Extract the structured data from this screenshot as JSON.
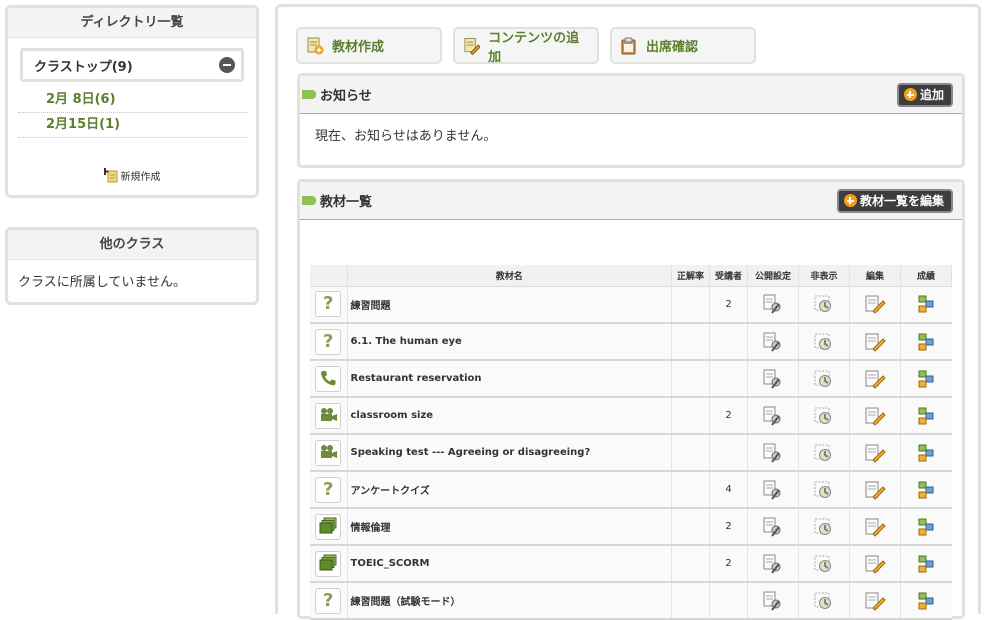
{
  "directory": {
    "title": "ディレクトリ一覧",
    "class_top": "クラストップ(9)",
    "dates": [
      "2月 8日(6)",
      "2月15日(1)"
    ],
    "new_create": "新規作成"
  },
  "other_classes": {
    "title": "他のクラス",
    "message": "クラスに所属していません。"
  },
  "toolbar": {
    "create_label": "教材作成",
    "add_content_label": "コンテンツの追加",
    "attendance_label": "出席確認"
  },
  "notice": {
    "title": "お知らせ",
    "add_label": "追加",
    "message": "現在、お知らせはありません。"
  },
  "materials": {
    "title": "教材一覧",
    "edit_label": "教材一覧を編集",
    "columns": {
      "name": "教材名",
      "accuracy": "正解率",
      "students": "受講者",
      "publish": "公開設定",
      "hidden": "非表示",
      "edit": "編集",
      "grades": "成績"
    },
    "rows": [
      {
        "type": "quiz-icon",
        "name": "練習問題",
        "accuracy": "",
        "students": "2"
      },
      {
        "type": "quiz-icon",
        "name": "6.1. The human eye",
        "accuracy": "",
        "students": ""
      },
      {
        "type": "phone-icon",
        "name": "Restaurant reservation",
        "accuracy": "",
        "students": ""
      },
      {
        "type": "video-camera-icon",
        "name": "classroom size",
        "accuracy": "",
        "students": "2"
      },
      {
        "type": "video-camera-icon",
        "name": "Speaking test --- Agreeing or disagreeing?",
        "accuracy": "",
        "students": ""
      },
      {
        "type": "quiz-icon",
        "name": "アンケートクイズ",
        "accuracy": "",
        "students": "4"
      },
      {
        "type": "slides-icon",
        "name": "情報倫理",
        "accuracy": "",
        "students": "2"
      },
      {
        "type": "slides-icon",
        "name": "TOEIC_SCORM",
        "accuracy": "",
        "students": "2"
      },
      {
        "type": "quiz-icon",
        "name": "練習問題（試験モード）",
        "accuracy": "",
        "students": ""
      }
    ]
  },
  "colors": {
    "accent_green": "#5b7f2a",
    "border": "#dfe3dc",
    "dark_button": "#3d3d3d"
  }
}
